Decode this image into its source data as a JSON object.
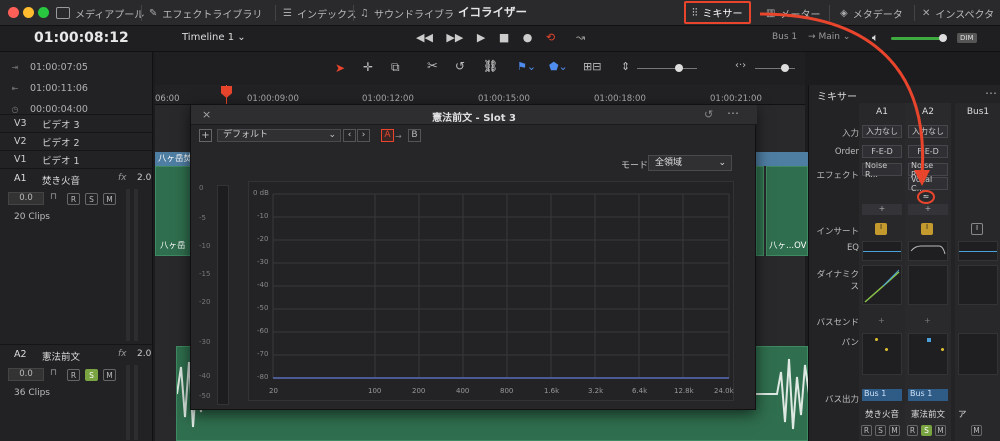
{
  "topbar": {
    "items": [
      "メディアプール",
      "エフェクトライブラリ",
      "インデックス",
      "サウンドライブラリ",
      "イコライザー",
      "ミキサー",
      "メーター",
      "メタデータ",
      "インスペクタ"
    ]
  },
  "transport": {
    "timecode": "01:00:08:12",
    "timeline": "Timeline 1",
    "bus": "Bus 1",
    "main": "Main",
    "dim": "DIM"
  },
  "timecodes": [
    "01:00:07:05",
    "01:00:11:06",
    "00:00:04:00"
  ],
  "tracks": [
    {
      "id": "V3",
      "name": "ビデオ 3"
    },
    {
      "id": "V2",
      "name": "ビデオ 2"
    },
    {
      "id": "V1",
      "name": "ビデオ 1"
    }
  ],
  "audio_tracks": [
    {
      "id": "A1",
      "name": "焚き火音",
      "fx": "fx",
      "vol": "2.0",
      "level": "0.0",
      "clips": "20 Clips"
    },
    {
      "id": "A2",
      "name": "憲法前文",
      "fx": "fx",
      "vol": "2.0",
      "level": "0.0",
      "clips": "36 Clips"
    }
  ],
  "ruler": [
    "06:00",
    "01:00:09:00",
    "01:00:12:00",
    "01:00:15:00",
    "01:00:18:00",
    "01:00:21:00"
  ],
  "clips": {
    "a1_left_title": "八ヶ岳焚",
    "a1_left_label": "八ヶ岳",
    "a1_right_label": "八ヶ...OV"
  },
  "dialog": {
    "title": "憲法前文 - Slot 3",
    "preset": "デフォルト",
    "mode_label": "モード",
    "mode_value": "全領域",
    "slot_a": "A",
    "slot_b": "B",
    "db_labels": [
      "0 dB",
      "-10",
      "-20",
      "-30",
      "-40",
      "-50",
      "-60",
      "-70",
      "-80"
    ],
    "freq_labels": [
      "20",
      "100",
      "200",
      "400",
      "800",
      "1.6k",
      "3.2k",
      "6.4k",
      "12.8k",
      "24.0k"
    ],
    "meter_labels": [
      "0",
      "-5",
      "-10",
      "-15",
      "-20",
      "-30",
      "-40",
      "-50"
    ]
  },
  "mixer": {
    "title": "ミキサー",
    "labels": [
      "入力",
      "Order",
      "エフェクト",
      "インサート",
      "EQ",
      "ダイナミクス",
      "バスセンド",
      "パン",
      "バス出力"
    ],
    "channels": [
      {
        "name": "A1",
        "input": "入力なし",
        "order": "F-E-D",
        "effect1": "Noise R...",
        "effect2": "",
        "bus": "Bus 1",
        "footer": "焚き火音"
      },
      {
        "name": "A2",
        "input": "入力なし",
        "order": "F-E-D",
        "effect1": "Noise R...",
        "effect2": "Vocal C...",
        "bus": "Bus 1",
        "footer": "憲法前文"
      },
      {
        "name": "Bus1",
        "input": "",
        "order": "",
        "effect1": "",
        "effect2": "",
        "bus": "",
        "footer": "ア"
      }
    ],
    "rsm": [
      "R",
      "S",
      "M"
    ]
  },
  "accent": "#e8452c",
  "colors": {
    "clip": "#2f6e4e",
    "clip_header": "#4f7ea3",
    "solo": "#7aa341"
  }
}
